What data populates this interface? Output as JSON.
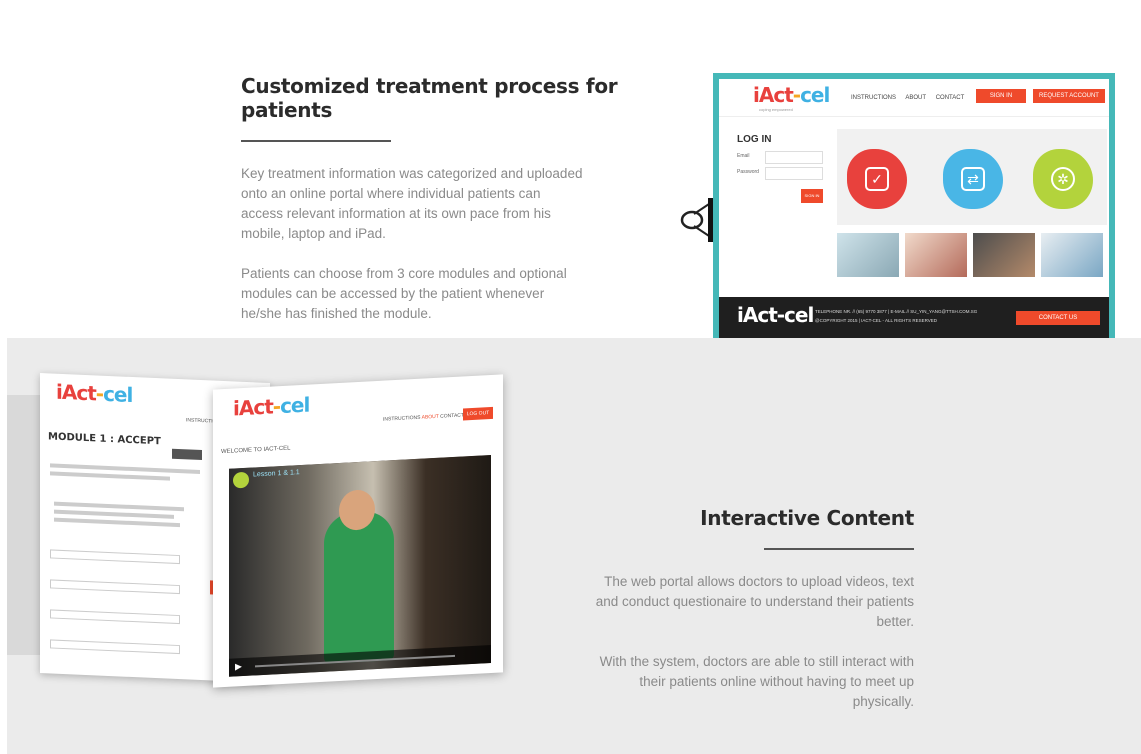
{
  "section1": {
    "title": "Customized treatment process for patients",
    "paragraph1": "Key treatment information was categorized and uploaded onto an online portal where individual patients can access relevant information at its own pace from his mobile, laptop and iPad.",
    "paragraph2": "Patients can choose from 3 core modules and optional modules can be accessed by the patient whenever he/she has finished the module."
  },
  "portal": {
    "logo_parts": [
      "iAct",
      "-",
      "cel"
    ],
    "tagline": "coping empowered",
    "nav": [
      "INSTRUCTIONS",
      "ABOUT",
      "CONTACT"
    ],
    "sign_in": "SIGN IN",
    "request_account": "REQUEST ACCOUNT",
    "login_title": "LOG IN",
    "email_label": "Email",
    "password_label": "Password",
    "login_button": "SIGN IN",
    "footer_logo": "iAct-cel",
    "footer_line1": "TELEPHONE NR. // (65) 9770 3877 | E-MAIL // SU_YIN_YANG@TTSH.COM.SG",
    "footer_line2": "@COPYRIGHT 2015 | IACT-CEL - ALL RIGHTS RESERVED",
    "contact_us": "CONTACT US",
    "colors": {
      "frame": "#45b8b8",
      "accent": "#ef4a2b",
      "red": "#e8413d",
      "blue": "#49b6e6",
      "green": "#b3d33c"
    }
  },
  "screens": {
    "left_logo": "iAct-cel",
    "left_nav": "INSTRUCTIO",
    "module_title": "MODULE 1 : ACCEPT",
    "right_logo": "iAct-cel",
    "right_nav": [
      "INSTRUCTIONS",
      "ABOUT",
      "CONTACT"
    ],
    "right_button": "LOG OUT",
    "welcome": "WELCOME TO IACT-CEL",
    "video_title": "Lesson 1 & 1.1"
  },
  "section2": {
    "title": "Interactive Content",
    "paragraph1": "The web portal allows doctors to upload videos, text and conduct questionaire to understand their patients better.",
    "paragraph2": "With the system, doctors are able to still interact with their patients online without having  to meet up physically."
  }
}
